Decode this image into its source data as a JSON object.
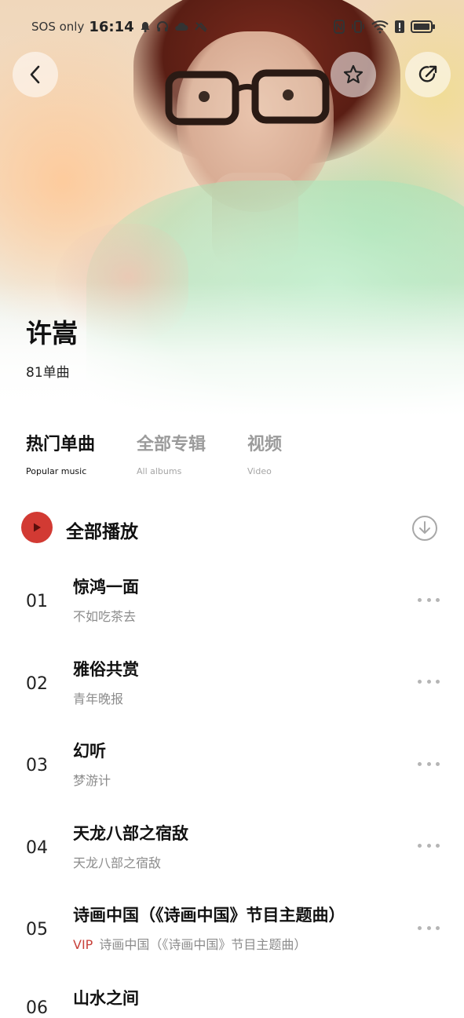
{
  "status_bar": {
    "network_text": "SOS only",
    "time": "16:14"
  },
  "artist": {
    "name": "许嵩",
    "count": "81单曲"
  },
  "tabs": [
    {
      "label": "热门单曲",
      "sub": "Popular music",
      "active": true
    },
    {
      "label": "全部专辑",
      "sub": "All albums",
      "active": false
    },
    {
      "label": "视频",
      "sub": "Video",
      "active": false
    }
  ],
  "play_all": {
    "label": "全部播放"
  },
  "songs": [
    {
      "num": "01",
      "title": "惊鸿一面",
      "album": "不如吃茶去",
      "vip": ""
    },
    {
      "num": "02",
      "title": "雅俗共赏",
      "album": "青年晚报",
      "vip": ""
    },
    {
      "num": "03",
      "title": "幻听",
      "album": "梦游计",
      "vip": ""
    },
    {
      "num": "04",
      "title": "天龙八部之宿敌",
      "album": "天龙八部之宿敌",
      "vip": ""
    },
    {
      "num": "05",
      "title": "诗画中国（《诗画中国》节目主题曲）",
      "album": "诗画中国（《诗画中国》节目主题曲）",
      "vip": "VIP"
    }
  ],
  "partial_song": {
    "num": "06",
    "title": "山水之间"
  },
  "colors": {
    "accent_red": "#d23a33",
    "vip_red": "#c8423b",
    "muted_text": "#8c8c8c"
  }
}
